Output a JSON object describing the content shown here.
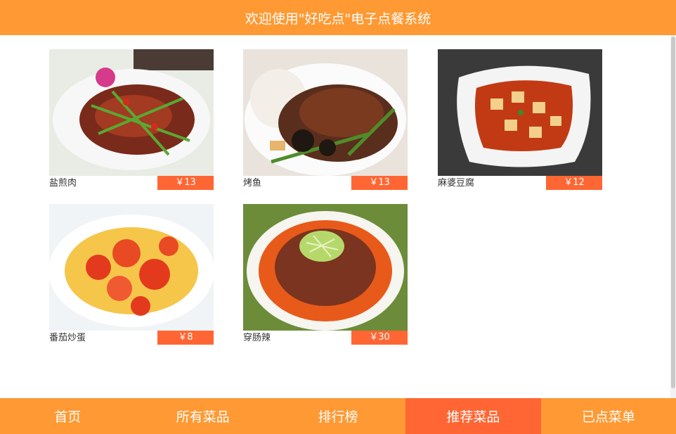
{
  "header": {
    "title": "欢迎使用\"好吃点\"电子点餐系统"
  },
  "dishes": [
    {
      "name": "盐煎肉",
      "price": "￥13",
      "image_icon": "stir-fried-pork-dish"
    },
    {
      "name": "烤鱼",
      "price": "￥13",
      "image_icon": "grilled-fish-dish"
    },
    {
      "name": "麻婆豆腐",
      "price": "￥12",
      "image_icon": "mapo-tofu-dish"
    },
    {
      "name": "番茄炒蛋",
      "price": "￥8",
      "image_icon": "tomato-egg-dish"
    },
    {
      "name": "穿肠辣",
      "price": "￥30",
      "image_icon": "spicy-minced-meat-dish"
    }
  ],
  "nav": {
    "items": [
      {
        "label": "首页"
      },
      {
        "label": "所有菜品"
      },
      {
        "label": "排行榜"
      },
      {
        "label": "推荐菜品",
        "active": true
      },
      {
        "label": "已点菜单"
      }
    ]
  },
  "colors": {
    "header": "#ff9933",
    "accent": "#ff6633",
    "text": "#333333"
  }
}
